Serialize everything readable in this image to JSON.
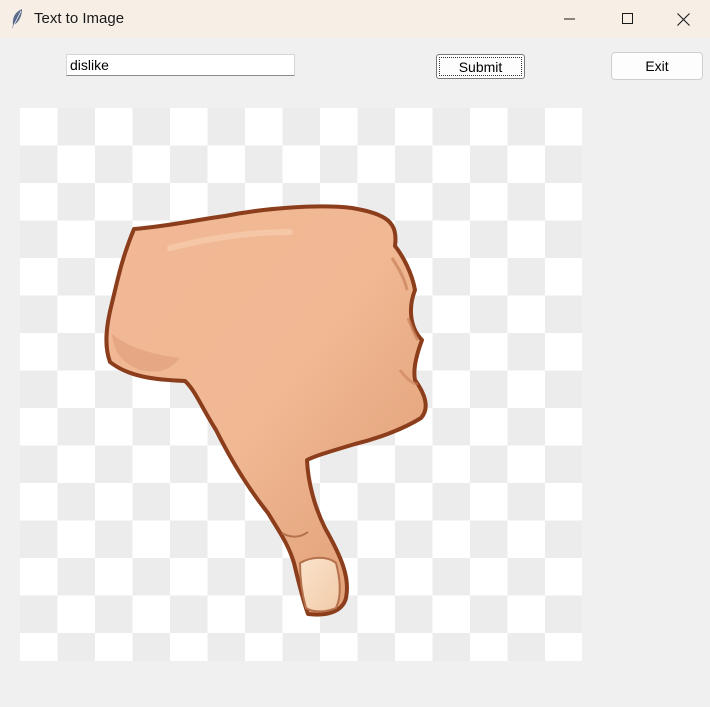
{
  "window": {
    "title": "Text to Image",
    "app_icon": "feather-icon",
    "controls": [
      "minimize-icon",
      "maximize-icon",
      "close-icon"
    ]
  },
  "form": {
    "prompt_value": "dislike",
    "submit_label": "Submit",
    "exit_label": "Exit"
  },
  "output": {
    "image_subject": "thumbs-down-hand",
    "background": "transparency-checkerboard"
  }
}
